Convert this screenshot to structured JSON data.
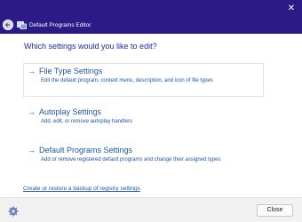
{
  "window": {
    "title": "Default Programs Editor",
    "close_symbol": "✕"
  },
  "heading": "Which settings would you like to edit?",
  "options": [
    {
      "title": "File Type Settings",
      "description": "Edit the default program, context menu, description, and icon of file types",
      "icon": "arrow-right-icon"
    },
    {
      "title": "Autoplay Settings",
      "description": "Add, edit, or remove autoplay handlers",
      "icon": "arrow-right-icon"
    },
    {
      "title": "Default Programs Settings",
      "description": "Add or remove registered default programs and change their assigned types",
      "icon": "arrow-right-icon"
    }
  ],
  "backup_link": "Create or restore a backup of registry settings",
  "footer": {
    "close_label": "Close",
    "settings_icon": "gear-icon"
  },
  "colors": {
    "titlebar": "#2c1b86",
    "link": "#1f56a8",
    "heading": "#1a2ba3"
  }
}
